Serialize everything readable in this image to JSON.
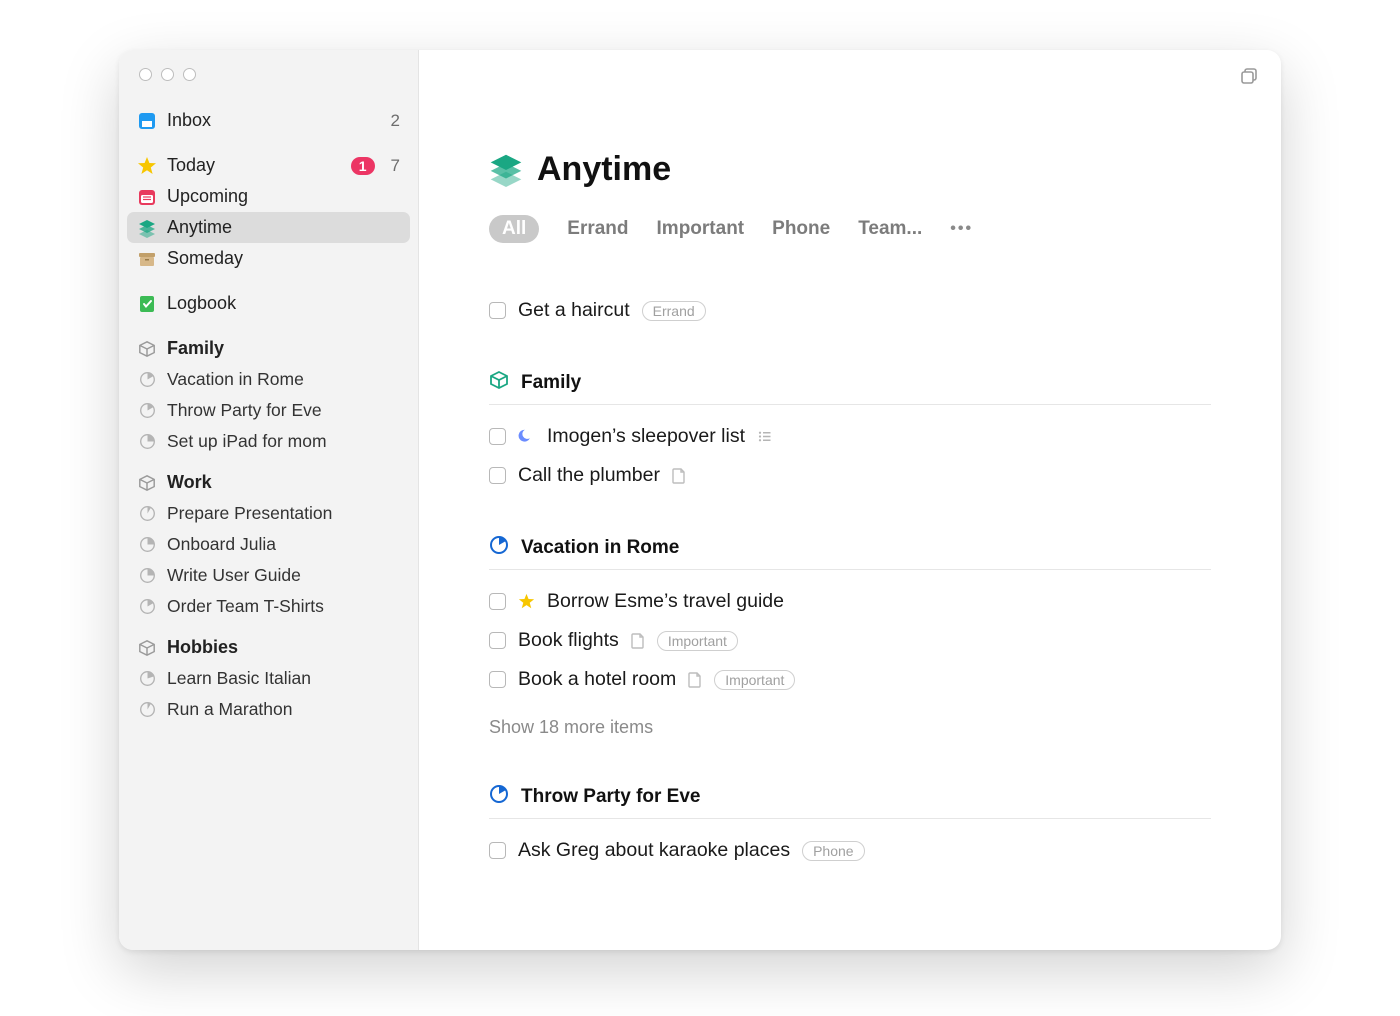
{
  "sidebar": {
    "inbox": {
      "label": "Inbox",
      "count": "2"
    },
    "today": {
      "label": "Today",
      "pill": "1",
      "count": "7"
    },
    "upcoming": {
      "label": "Upcoming"
    },
    "anytime": {
      "label": "Anytime"
    },
    "someday": {
      "label": "Someday"
    },
    "logbook": {
      "label": "Logbook"
    },
    "areas": [
      {
        "name": "Family",
        "projects": [
          "Vacation in Rome",
          "Throw Party for Eve",
          "Set up iPad for mom"
        ]
      },
      {
        "name": "Work",
        "projects": [
          "Prepare Presentation",
          "Onboard Julia",
          "Write User Guide",
          "Order Team T-Shirts"
        ]
      },
      {
        "name": "Hobbies",
        "projects": [
          "Learn Basic Italian",
          "Run a Marathon"
        ]
      }
    ]
  },
  "main": {
    "title": "Anytime",
    "filters": [
      "All",
      "Errand",
      "Important",
      "Phone",
      "Team..."
    ],
    "ungrouped": [
      {
        "title": "Get a haircut",
        "tag": "Errand"
      }
    ],
    "sections": [
      {
        "heading": "Family",
        "icon": "box",
        "tasks": [
          {
            "title": "Imogen’s sleepover list",
            "prefix_icon": "moon",
            "suffix_icon": "checklist"
          },
          {
            "title": "Call the plumber",
            "suffix_icon": "note"
          }
        ]
      },
      {
        "heading": "Vacation in Rome",
        "icon": "progress",
        "tasks": [
          {
            "title": "Borrow Esme’s travel guide",
            "prefix_icon": "star"
          },
          {
            "title": "Book flights",
            "suffix_icon": "note",
            "tag": "Important"
          },
          {
            "title": "Book a hotel room",
            "suffix_icon": "note",
            "tag": "Important"
          }
        ],
        "show_more": "Show 18 more items"
      },
      {
        "heading": "Throw Party for Eve",
        "icon": "progress",
        "tasks": [
          {
            "title": "Ask Greg about karaoke places",
            "tag": "Phone"
          }
        ]
      }
    ]
  }
}
